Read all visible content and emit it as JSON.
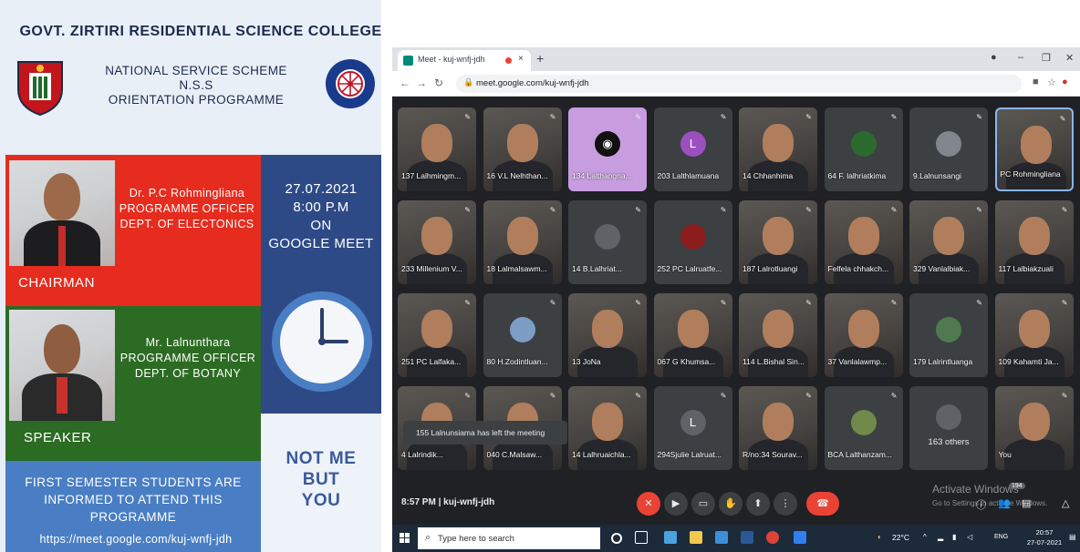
{
  "poster": {
    "title": "GOVT. ZIRTIRI RESIDENTIAL SCIENCE COLLEGE",
    "scheme": "NATIONAL SERVICE SCHEME",
    "scheme_short": "N.S.S",
    "programme": "ORIENTATION PROGRAMME",
    "chairman": {
      "role": "CHAIRMAN",
      "name": "Dr. P.C Rohmingliana",
      "title": "PROGRAMME OFFICER",
      "dept": "DEPT. OF ELECTONICS"
    },
    "speaker": {
      "role": "SPEAKER",
      "name": "Mr. Lalnunthara",
      "title": "PROGRAMME OFFICER",
      "dept": "DEPT. OF BOTANY"
    },
    "date": "27.07.2021",
    "time": "8:00 P.M",
    "on": "ON",
    "platform": "GOOGLE MEET",
    "slogan": [
      "NOT ME",
      "BUT",
      "YOU"
    ],
    "notice": "FIRST SEMESTER STUDENTS ARE INFORMED TO ATTEND THIS PROGRAMME",
    "url": "https://meet.google.com/kuj-wnfj-jdh"
  },
  "browser": {
    "tab_title": "Meet - kuj-wnfj-jdh",
    "tab_close": "×",
    "new_tab": "+",
    "address": "meet.google.com/kuj-wnfj-jdh"
  },
  "meet": {
    "participants": [
      {
        "name": "137 Lalhmingm...",
        "kind": "video"
      },
      {
        "name": "16 V.L Nelhthan...",
        "kind": "video"
      },
      {
        "name": "134 Lalthangna...",
        "kind": "image",
        "color": "#c89de0"
      },
      {
        "name": "203 Lalthlamuana",
        "kind": "avatar",
        "initial": "L",
        "color": "#9c4fbf"
      },
      {
        "name": "14 Chhanhima",
        "kind": "video"
      },
      {
        "name": "64 F. lalhriatkima",
        "kind": "avatar",
        "initial": "",
        "color": "#2b6a2f"
      },
      {
        "name": "9.Lalnunsangi",
        "kind": "avatar",
        "initial": "",
        "color": "#80868b"
      },
      {
        "name": "PC Rohmingliana",
        "kind": "video",
        "active": true
      },
      {
        "name": "233 Millenium V...",
        "kind": "video"
      },
      {
        "name": "18 Lalmalsawm...",
        "kind": "video"
      },
      {
        "name": "14 B.Lalhriat...",
        "kind": "avatar",
        "initial": "",
        "color": "#5f6368"
      },
      {
        "name": "252 PC Lalruatfe...",
        "kind": "avatar",
        "initial": "",
        "color": "#8b1d1d"
      },
      {
        "name": "187 Lalrotluangi",
        "kind": "video"
      },
      {
        "name": "Felfela chhakch...",
        "kind": "video"
      },
      {
        "name": "329 Vanlalbiak...",
        "kind": "video"
      },
      {
        "name": "117 Lalbiakzuali",
        "kind": "video"
      },
      {
        "name": "251 PC Lalfaka...",
        "kind": "video"
      },
      {
        "name": "80 H.Zodintluan...",
        "kind": "avatar",
        "initial": "",
        "color": "#7c9ec4"
      },
      {
        "name": "13 JoNa",
        "kind": "video"
      },
      {
        "name": "067 G Khumsa...",
        "kind": "video"
      },
      {
        "name": "114 L.Bishal Sin...",
        "kind": "video"
      },
      {
        "name": "37 Vanlalawmp...",
        "kind": "video"
      },
      {
        "name": "179 Lalrintluanga",
        "kind": "avatar",
        "initial": "",
        "color": "#4f7a4f"
      },
      {
        "name": "109 Kahamti Ja...",
        "kind": "video"
      },
      {
        "name": "4 Lalrindik...",
        "kind": "video"
      },
      {
        "name": "040 C.Malsaw...",
        "kind": "video"
      },
      {
        "name": "14 Lalhruaichla...",
        "kind": "video"
      },
      {
        "name": "294Sjulie Lalruat...",
        "kind": "avatar",
        "initial": "L",
        "color": "#5f6368"
      },
      {
        "name": "R/no:34 Sourav...",
        "kind": "video"
      },
      {
        "name": "BCA Lalthanzam...",
        "kind": "avatar",
        "initial": "",
        "color": "#6f8a4a"
      },
      {
        "name": "",
        "kind": "others",
        "label": "163 others"
      },
      {
        "name": "You",
        "kind": "video"
      }
    ],
    "toast": "155 Lalnunsiama has left the meeting",
    "clock": "8:57 PM",
    "separator": "|",
    "code": "kuj-wnfj-jdh",
    "participant_badge": "194",
    "activate_title": "Activate Windows",
    "activate_sub": "Go to Settings to activate Windows."
  },
  "taskbar": {
    "search_placeholder": "Type here to search",
    "temperature": "22°C",
    "lang": "ENG",
    "time": "20:57",
    "date": "27-07-2021"
  },
  "colors": {
    "red_block": "#e62c1e",
    "green_block": "#2c6b23",
    "blue_block": "#4a7ec4",
    "navy_block": "#2e4a86",
    "meet_bg": "#202124",
    "end_call": "#ea4335"
  }
}
